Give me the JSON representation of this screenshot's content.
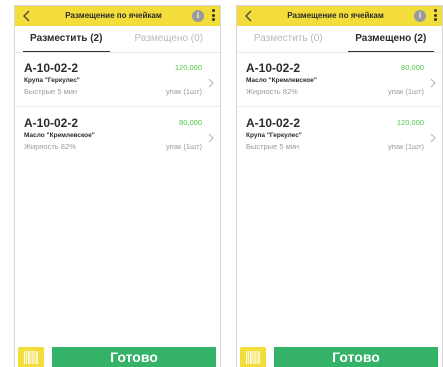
{
  "colors": {
    "topbar": "#f2dd3a",
    "accent_green": "#33b268",
    "qty_green": "#52c74a"
  },
  "screens": [
    {
      "title": "Размещение по ячейкам",
      "tabs": [
        {
          "label": "Разместить (2)",
          "active": true
        },
        {
          "label": "Размещено (0)",
          "active": false
        }
      ],
      "items": [
        {
          "cell": "A-10-02-2",
          "qty": "120,000",
          "product": "Крупа \"Геркулес\"",
          "desc": "Быстрые 5 мин",
          "unit": "упак (1шт)"
        },
        {
          "cell": "A-10-02-2",
          "qty": "80,000",
          "product": "Масло \"Кремлевское\"",
          "desc": "Жирность 82%",
          "unit": "упак (1шт)"
        }
      ],
      "done_label": "Готово"
    },
    {
      "title": "Размещение по ячейкам",
      "tabs": [
        {
          "label": "Разместить (0)",
          "active": false
        },
        {
          "label": "Размещено (2)",
          "active": true
        }
      ],
      "items": [
        {
          "cell": "A-10-02-2",
          "qty": "80,000",
          "product": "Масло \"Кремлевское\"",
          "desc": "Жирность 82%",
          "unit": "упак (1шт)"
        },
        {
          "cell": "A-10-02-2",
          "qty": "120,000",
          "product": "Крупа \"Геркулес\"",
          "desc": "Быстрые 5 мин",
          "unit": "упак (1шт)"
        }
      ],
      "done_label": "Готово"
    }
  ],
  "icons": {
    "back": "chevron-left-icon",
    "info": "info-icon",
    "more": "more-vertical-icon",
    "chevron": "chevron-right-icon",
    "scan": "barcode-scan-icon"
  }
}
